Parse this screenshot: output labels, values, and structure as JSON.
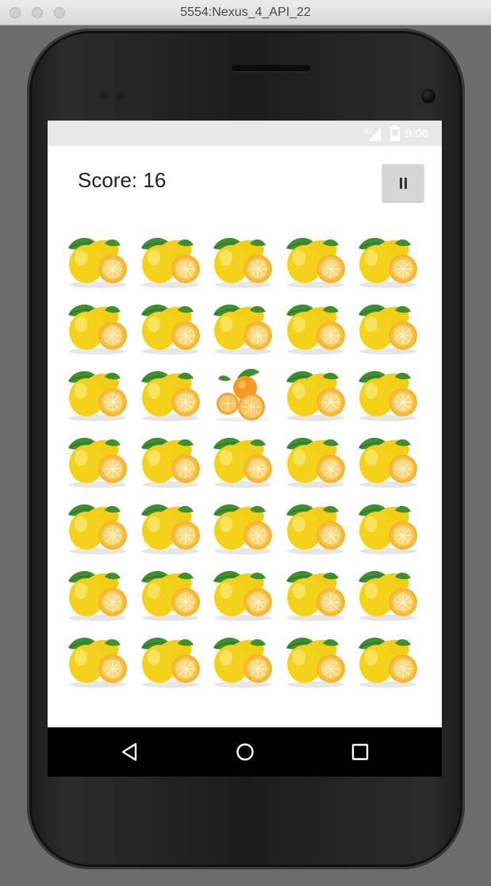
{
  "window": {
    "title": "5554:Nexus_4_API_22"
  },
  "status_bar": {
    "time": "9:06",
    "network": "3G"
  },
  "game": {
    "score_label": "Score: 16",
    "pause_icon": "pause-icon",
    "grid": {
      "rows": 7,
      "columns": 5,
      "tile_default": "lemon",
      "tiles": [
        [
          "lemon",
          "lemon",
          "lemon",
          "lemon",
          "lemon"
        ],
        [
          "lemon",
          "lemon",
          "lemon",
          "lemon",
          "lemon"
        ],
        [
          "lemon",
          "lemon",
          "orange",
          "lemon",
          "lemon"
        ],
        [
          "lemon",
          "lemon",
          "lemon",
          "lemon",
          "lemon"
        ],
        [
          "lemon",
          "lemon",
          "lemon",
          "lemon",
          "lemon"
        ],
        [
          "lemon",
          "lemon",
          "lemon",
          "lemon",
          "lemon"
        ],
        [
          "lemon",
          "lemon",
          "lemon",
          "lemon",
          "lemon"
        ]
      ]
    }
  },
  "nav_bar": {
    "icons": [
      "back-icon",
      "home-icon",
      "recents-icon"
    ]
  },
  "colors": {
    "lemon": "#f4d21c",
    "lemon_slice": "#f6c04a",
    "orange": "#f59a1b",
    "leaf": "#3e8f2f",
    "status_bar_bg": "#e8e8e8",
    "nav_bar_bg": "#000000"
  }
}
